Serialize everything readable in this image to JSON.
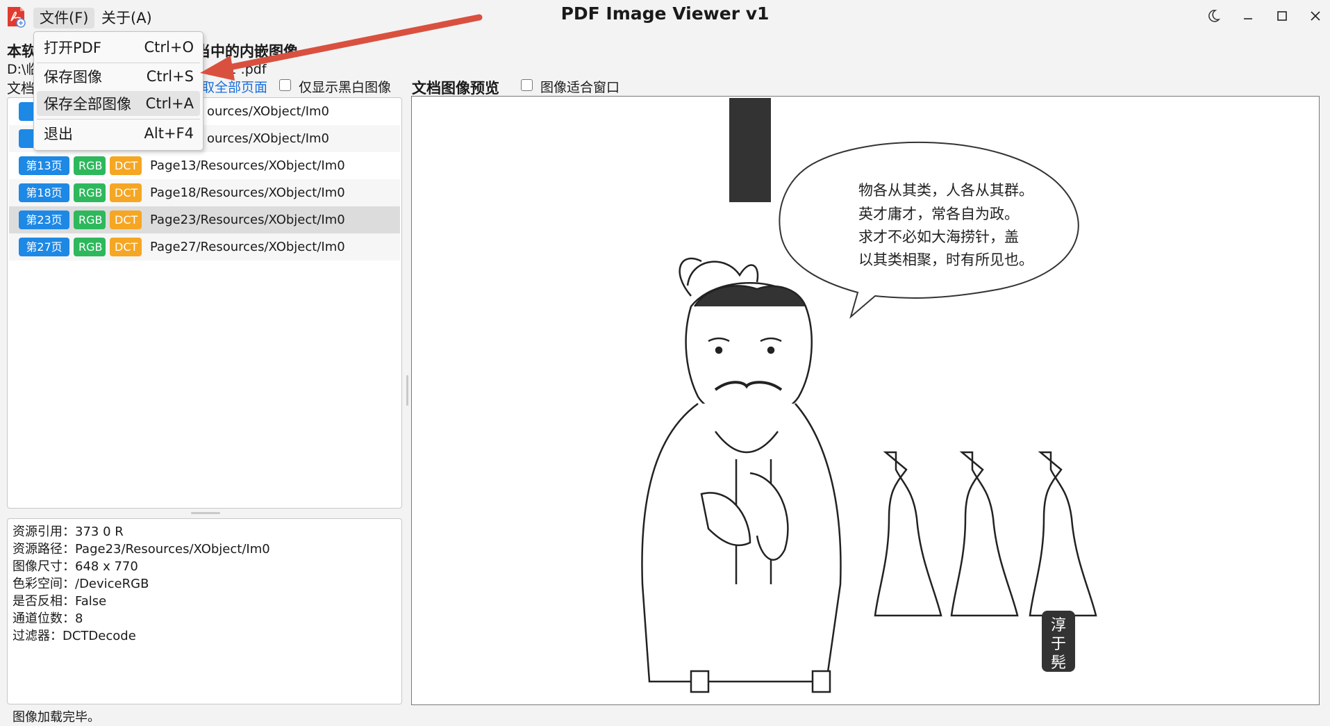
{
  "window": {
    "title": "PDF Image Viewer v1",
    "menus": [
      "文件(F)",
      "关于(A)"
    ]
  },
  "file_menu": {
    "items": [
      {
        "label": "打开PDF",
        "shortcut": "Ctrl+O"
      },
      {
        "label": "保存图像",
        "shortcut": "Ctrl+S"
      },
      {
        "label": "保存全部图像",
        "shortcut": "Ctrl+A"
      },
      {
        "label": "退出",
        "shortcut": "Alt+F4"
      }
    ]
  },
  "header": {
    "description": "本软…当中的内嵌图像",
    "description_left": "本软",
    "description_right": "当中的内嵌图像",
    "file_path_left": "D:\\临",
    "file_path_right": "91 .pdf",
    "doc_label": "文档",
    "extract_link": "取全部页面",
    "bw_only_label": "仅显示黑白图像",
    "preview_title": "文档图像预览",
    "fit_window_label": "图像适合窗口"
  },
  "image_list": [
    {
      "page": "第",
      "color": "",
      "filter": "",
      "path": "ources/XObject/Im0",
      "partial": true
    },
    {
      "page": "第",
      "color": "",
      "filter": "",
      "path": "ources/XObject/Im0",
      "partial": true
    },
    {
      "page": "第13页",
      "color": "RGB",
      "filter": "DCT",
      "path": "Page13/Resources/XObject/Im0"
    },
    {
      "page": "第18页",
      "color": "RGB",
      "filter": "DCT",
      "path": "Page18/Resources/XObject/Im0"
    },
    {
      "page": "第23页",
      "color": "RGB",
      "filter": "DCT",
      "path": "Page23/Resources/XObject/Im0",
      "selected": true
    },
    {
      "page": "第27页",
      "color": "RGB",
      "filter": "DCT",
      "path": "Page27/Resources/XObject/Im0"
    }
  ],
  "info": {
    "lines": [
      "资源引用：373 0 R",
      "资源路径：Page23/Resources/XObject/Im0",
      "图像尺寸：648 x 770",
      "色彩空间：/DeviceRGB",
      "是否反相：False",
      "通道位数：8",
      "过滤器：DCTDecode"
    ]
  },
  "preview": {
    "speech_bubble": [
      "物各从其类，人各从其群。",
      "英才庸才，常各自为政。",
      "求才不必如大海捞针，盖",
      "以其类相聚，时有所见也。"
    ],
    "seal": [
      "淳",
      "于",
      "髡"
    ]
  },
  "status": "图像加载完毕。",
  "colors": {
    "page_tag": "#1e88e5",
    "rgb_tag": "#2eb85c",
    "dct_tag": "#f5a623",
    "link": "#1a6fd8",
    "annotation_arrow": "#d9503f"
  },
  "icons": [
    "pdf-app-icon",
    "moon-icon",
    "minimize-icon",
    "maximize-icon",
    "close-icon"
  ]
}
